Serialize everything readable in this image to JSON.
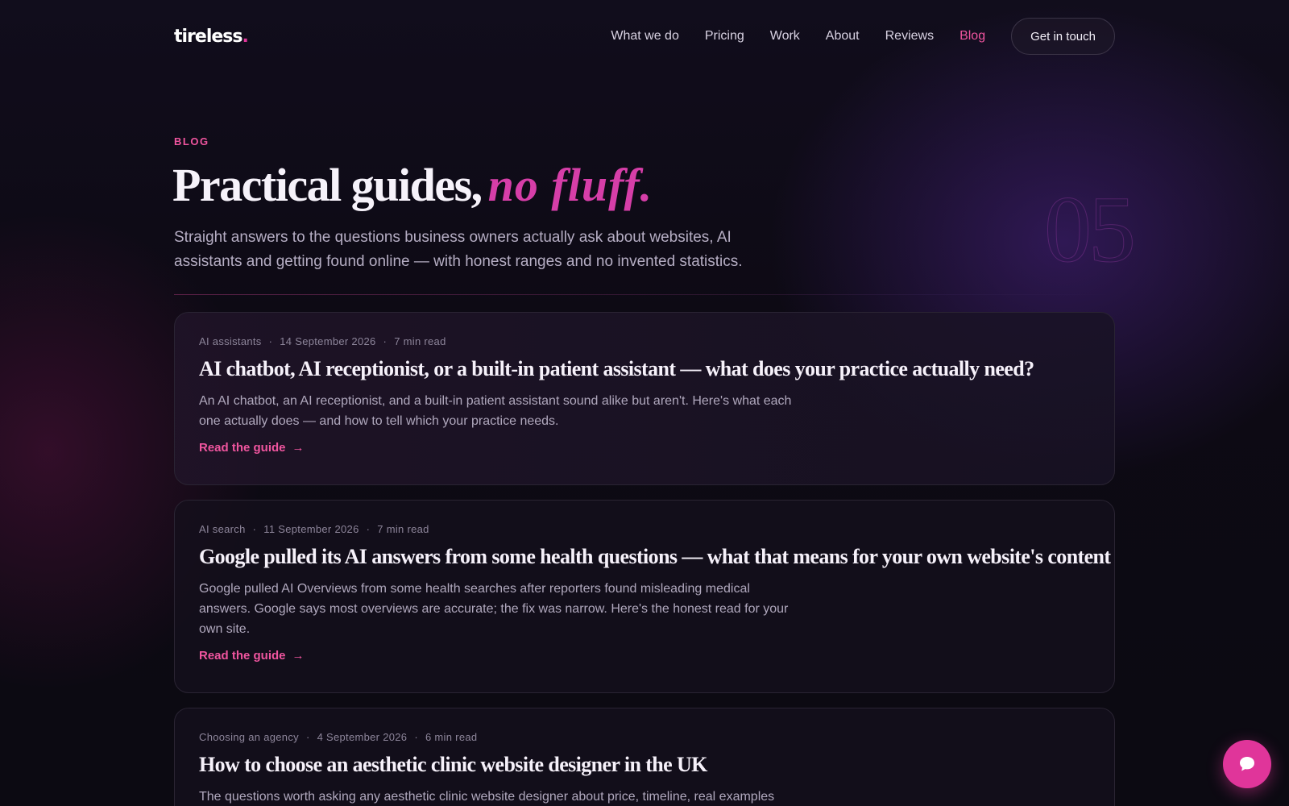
{
  "brand": {
    "logo_text": "tireless",
    "logo_dot": ".",
    "accent_color": "#e0359a",
    "link_color": "#f0559f"
  },
  "nav": {
    "items": [
      {
        "label": "What we do",
        "active": false
      },
      {
        "label": "Pricing",
        "active": false
      },
      {
        "label": "Work",
        "active": false
      },
      {
        "label": "About",
        "active": false
      },
      {
        "label": "Reviews",
        "active": false
      },
      {
        "label": "Blog",
        "active": true
      }
    ],
    "cta_label": "Get in touch"
  },
  "hero": {
    "eyebrow": "BLOG",
    "title": "Practical guides,",
    "title_accent": "no fluff.",
    "subtitle": "Straight answers to the questions business owners actually ask about websites, AI assistants and getting found online — with honest ranges and no invented statistics.",
    "count": "05"
  },
  "posts": [
    {
      "category": "AI assistants",
      "date": "14 September 2026",
      "read_time": "7 min read",
      "title": "AI chatbot, AI receptionist, or a built-in patient assistant — what does your practice actually need?",
      "excerpt": "An AI chatbot, an AI receptionist, and a built-in patient assistant sound alike but aren't. Here's what each one actually does — and how to tell which your practice needs.",
      "link_label": "Read the guide",
      "arrow": "→"
    },
    {
      "category": "AI search",
      "date": "11 September 2026",
      "read_time": "7 min read",
      "title": "Google pulled its AI answers from some health questions — what that means for your own website's content",
      "excerpt": "Google pulled AI Overviews from some health searches after reporters found misleading medical answers. Google says most overviews are accurate; the fix was narrow. Here's the honest read for your own site.",
      "link_label": "Read the guide",
      "arrow": "→"
    },
    {
      "category": "Choosing an agency",
      "date": "4 September 2026",
      "read_time": "6 min read",
      "title": "How to choose an aesthetic clinic website designer in the UK",
      "excerpt": "The questions worth asking any aesthetic clinic website designer about price, timeline, real examples",
      "link_label": "",
      "arrow": ""
    }
  ],
  "meta_separator": "·",
  "chat": {
    "icon": "chat-bubble-icon"
  }
}
